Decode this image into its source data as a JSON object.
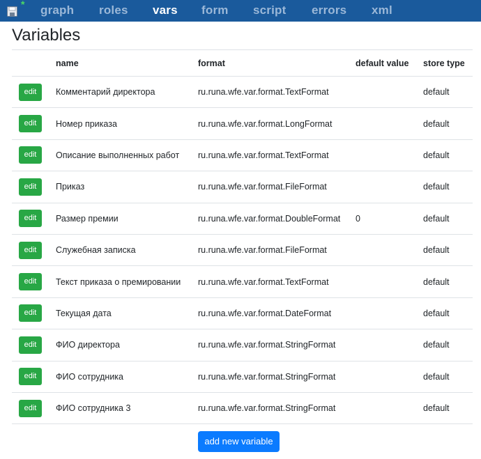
{
  "topbar": {
    "modified_marker": "*",
    "tabs": [
      {
        "label": "graph",
        "active": false
      },
      {
        "label": "roles",
        "active": false
      },
      {
        "label": "vars",
        "active": true
      },
      {
        "label": "form",
        "active": false
      },
      {
        "label": "script",
        "active": false
      },
      {
        "label": "errors",
        "active": false
      },
      {
        "label": "xml",
        "active": false
      }
    ]
  },
  "page": {
    "title": "Variables"
  },
  "table": {
    "headers": [
      "",
      "name",
      "format",
      "default value",
      "store type"
    ],
    "edit_label": "edit",
    "rows": [
      {
        "name": "Комментарий директора",
        "format": "ru.runa.wfe.var.format.TextFormat",
        "default_value": "",
        "store_type": "default"
      },
      {
        "name": "Номер приказа",
        "format": "ru.runa.wfe.var.format.LongFormat",
        "default_value": "",
        "store_type": "default"
      },
      {
        "name": "Описание выполненных работ",
        "format": "ru.runa.wfe.var.format.TextFormat",
        "default_value": "",
        "store_type": "default"
      },
      {
        "name": "Приказ",
        "format": "ru.runa.wfe.var.format.FileFormat",
        "default_value": "",
        "store_type": "default"
      },
      {
        "name": "Размер премии",
        "format": "ru.runa.wfe.var.format.DoubleFormat",
        "default_value": "0",
        "store_type": "default"
      },
      {
        "name": "Служебная записка",
        "format": "ru.runa.wfe.var.format.FileFormat",
        "default_value": "",
        "store_type": "default"
      },
      {
        "name": "Текст приказа о премировании",
        "format": "ru.runa.wfe.var.format.TextFormat",
        "default_value": "",
        "store_type": "default"
      },
      {
        "name": "Текущая дата",
        "format": "ru.runa.wfe.var.format.DateFormat",
        "default_value": "",
        "store_type": "default"
      },
      {
        "name": "ФИО директора",
        "format": "ru.runa.wfe.var.format.StringFormat",
        "default_value": "",
        "store_type": "default"
      },
      {
        "name": "ФИО сотрудника",
        "format": "ru.runa.wfe.var.format.StringFormat",
        "default_value": "",
        "store_type": "default"
      },
      {
        "name": "ФИО сотрудника 3",
        "format": "ru.runa.wfe.var.format.StringFormat",
        "default_value": "",
        "store_type": "default"
      }
    ]
  },
  "actions": {
    "add_label": "add new variable"
  },
  "colors": {
    "topbar": "#1a5a9c",
    "edit_button": "#28a745",
    "add_button": "#0b7bff",
    "modified_marker": "#4cd964"
  },
  "icons": {
    "save": "floppy-disk-icon"
  }
}
